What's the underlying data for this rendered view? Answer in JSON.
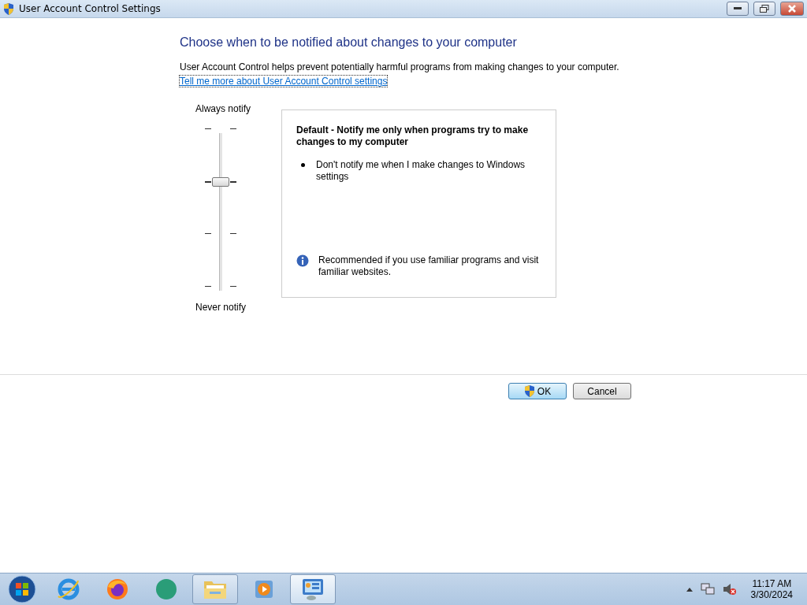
{
  "window": {
    "title": "User Account Control Settings"
  },
  "heading": "Choose when to be notified about changes to your computer",
  "description": "User Account Control helps prevent potentially harmful programs from making changes to your computer.",
  "help_link": "Tell me more about User Account Control settings",
  "slider": {
    "top_label": "Always notify",
    "bottom_label": "Never notify",
    "level": 0.667
  },
  "setting": {
    "title": "Default - Notify me only when programs try to make changes to my computer",
    "bullets": [
      "Don't notify me when I make changes to Windows settings"
    ],
    "note": "Recommended if you use familiar programs and visit familiar websites."
  },
  "buttons": [
    {
      "label": "OK",
      "kind": "shield",
      "default": true
    },
    {
      "label": "Cancel",
      "kind": "plain",
      "default": false
    }
  ],
  "taskbar": {
    "items": [
      {
        "kind": "ie",
        "running": false,
        "selected": false
      },
      {
        "kind": "firefox",
        "running": false,
        "selected": false
      },
      {
        "kind": "green",
        "running": false,
        "selected": false
      },
      {
        "kind": "folder",
        "running": true,
        "selected": false
      },
      {
        "kind": "media",
        "running": false,
        "selected": false
      },
      {
        "kind": "control",
        "running": true,
        "selected": true
      }
    ],
    "time": "11:17 AM",
    "date": "3/30/2024"
  }
}
